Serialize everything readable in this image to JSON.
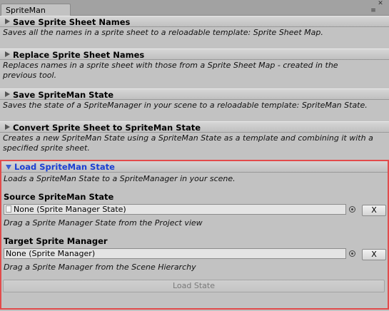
{
  "window": {
    "tab_title": "SpriteMan",
    "menu_glyph": "≡",
    "close_glyph": "✕"
  },
  "sections": [
    {
      "title": "Save Sprite Sheet Names",
      "description": "Saves all the names in a sprite sheet to a reloadable template: Sprite Sheet Map."
    },
    {
      "title": "Replace Sprite Sheet Names",
      "description_line1": "Replaces names in a sprite sheet with those from a Sprite Sheet Map - created in the",
      "description_line2": "previous tool."
    },
    {
      "title": "Save SpriteMan State",
      "description": "Saves the state of a SpriteManager in your scene to a reloadable template: SpriteMan State."
    },
    {
      "title": "Convert Sprite Sheet to SpriteMan State",
      "description_line1": "Creates a new SpriteMan State using a SpriteMan State as a template and combining it with a",
      "description_line2": "specified sprite sheet."
    }
  ],
  "active_section": {
    "title": "Load SpriteMan State",
    "description": "Loads a SpriteMan State to a SpriteManager in your scene.",
    "source": {
      "label": "Source SpriteMan State",
      "value": "None (Sprite Manager State)",
      "hint": "Drag a Sprite Manager State from the Project view",
      "clear_label": "X"
    },
    "target": {
      "label": "Target Sprite Manager",
      "value": "None (Sprite Manager)",
      "hint": "Drag a Sprite Manager from the Scene Hierarchy",
      "clear_label": "X"
    },
    "load_button": "Load State"
  },
  "colors": {
    "highlight_border": "#e24b4b",
    "active_title": "#1a3fd3"
  }
}
